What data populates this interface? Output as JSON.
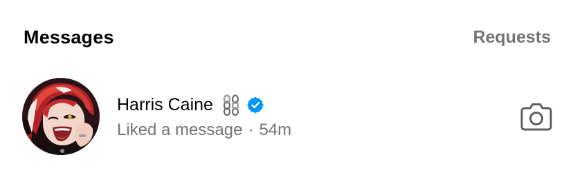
{
  "header": {
    "title": "Messages",
    "requests_label": "Requests"
  },
  "threads": [
    {
      "name": "Harris Caine",
      "name_icons": [
        "chain-icon",
        "verified-badge-icon"
      ],
      "activity": "Liked a message",
      "separator": "·",
      "time": "54m",
      "action_icon": "camera-icon"
    }
  ],
  "colors": {
    "text_primary": "#000000",
    "text_secondary": "#737373",
    "verified_blue": "#0095f6"
  }
}
